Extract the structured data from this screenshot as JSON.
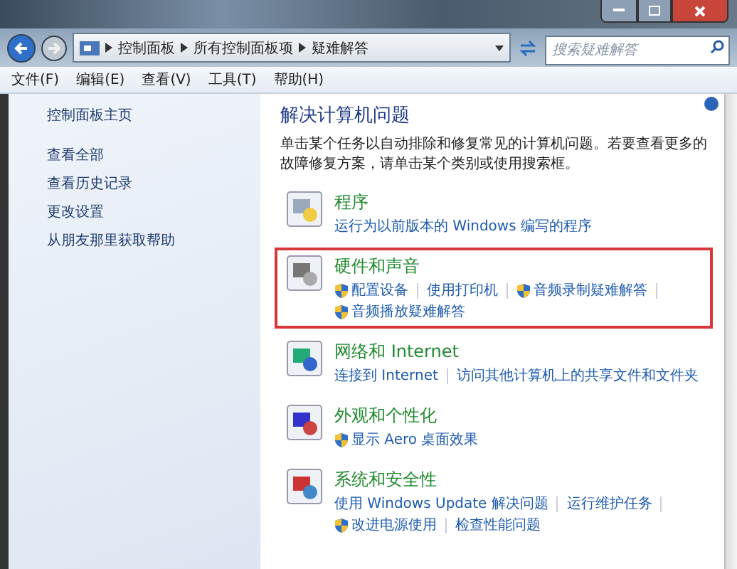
{
  "breadcrumb": [
    "控制面板",
    "所有控制面板项",
    "疑难解答"
  ],
  "search": {
    "placeholder": "搜索疑难解答"
  },
  "menu": [
    "文件(F)",
    "编辑(E)",
    "查看(V)",
    "工具(T)",
    "帮助(H)"
  ],
  "sidebar": {
    "home": "控制面板主页",
    "items": [
      "查看全部",
      "查看历史记录",
      "更改设置",
      "从朋友那里获取帮助"
    ]
  },
  "heading": "解决计算机问题",
  "description": "单击某个任务以自动排除和修复常见的计算机问题。若要查看更多的故障修复方案，请单击某个类别或使用搜索框。",
  "categories": [
    {
      "title": "程序",
      "kind": "programs",
      "highlighted": false,
      "links": [
        {
          "text": "运行为以前版本的 Windows 编写的程序",
          "shield": false
        }
      ]
    },
    {
      "title": "硬件和声音",
      "kind": "hardware",
      "highlighted": true,
      "links": [
        {
          "text": "配置设备",
          "shield": true
        },
        {
          "text": "使用打印机",
          "shield": false
        },
        {
          "text": "音频录制疑难解答",
          "shield": true
        },
        {
          "text": "音频播放疑难解答",
          "shield": true
        }
      ]
    },
    {
      "title": "网络和 Internet",
      "kind": "network",
      "highlighted": false,
      "links": [
        {
          "text": "连接到 Internet",
          "shield": false
        },
        {
          "text": "访问其他计算机上的共享文件和文件夹",
          "shield": false
        }
      ]
    },
    {
      "title": "外观和个性化",
      "kind": "appearance",
      "highlighted": false,
      "links": [
        {
          "text": "显示 Aero 桌面效果",
          "shield": true
        }
      ]
    },
    {
      "title": "系统和安全性",
      "kind": "system",
      "highlighted": false,
      "links": [
        {
          "text": "使用 Windows Update 解决问题",
          "shield": false
        },
        {
          "text": "运行维护任务",
          "shield": false
        },
        {
          "text": "改进电源使用",
          "shield": true
        },
        {
          "text": "检查性能问题",
          "shield": false
        }
      ]
    }
  ]
}
